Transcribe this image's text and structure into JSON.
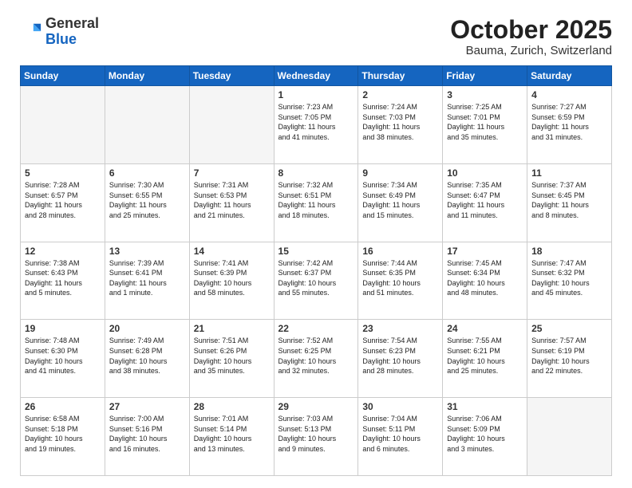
{
  "header": {
    "logo_general": "General",
    "logo_blue": "Blue",
    "month_title": "October 2025",
    "location": "Bauma, Zurich, Switzerland"
  },
  "days_of_week": [
    "Sunday",
    "Monday",
    "Tuesday",
    "Wednesday",
    "Thursday",
    "Friday",
    "Saturday"
  ],
  "weeks": [
    [
      {
        "day": "",
        "info": "",
        "empty": true
      },
      {
        "day": "",
        "info": "",
        "empty": true
      },
      {
        "day": "",
        "info": "",
        "empty": true
      },
      {
        "day": "1",
        "info": "Sunrise: 7:23 AM\nSunset: 7:05 PM\nDaylight: 11 hours\nand 41 minutes.",
        "empty": false
      },
      {
        "day": "2",
        "info": "Sunrise: 7:24 AM\nSunset: 7:03 PM\nDaylight: 11 hours\nand 38 minutes.",
        "empty": false
      },
      {
        "day": "3",
        "info": "Sunrise: 7:25 AM\nSunset: 7:01 PM\nDaylight: 11 hours\nand 35 minutes.",
        "empty": false
      },
      {
        "day": "4",
        "info": "Sunrise: 7:27 AM\nSunset: 6:59 PM\nDaylight: 11 hours\nand 31 minutes.",
        "empty": false
      }
    ],
    [
      {
        "day": "5",
        "info": "Sunrise: 7:28 AM\nSunset: 6:57 PM\nDaylight: 11 hours\nand 28 minutes.",
        "empty": false
      },
      {
        "day": "6",
        "info": "Sunrise: 7:30 AM\nSunset: 6:55 PM\nDaylight: 11 hours\nand 25 minutes.",
        "empty": false
      },
      {
        "day": "7",
        "info": "Sunrise: 7:31 AM\nSunset: 6:53 PM\nDaylight: 11 hours\nand 21 minutes.",
        "empty": false
      },
      {
        "day": "8",
        "info": "Sunrise: 7:32 AM\nSunset: 6:51 PM\nDaylight: 11 hours\nand 18 minutes.",
        "empty": false
      },
      {
        "day": "9",
        "info": "Sunrise: 7:34 AM\nSunset: 6:49 PM\nDaylight: 11 hours\nand 15 minutes.",
        "empty": false
      },
      {
        "day": "10",
        "info": "Sunrise: 7:35 AM\nSunset: 6:47 PM\nDaylight: 11 hours\nand 11 minutes.",
        "empty": false
      },
      {
        "day": "11",
        "info": "Sunrise: 7:37 AM\nSunset: 6:45 PM\nDaylight: 11 hours\nand 8 minutes.",
        "empty": false
      }
    ],
    [
      {
        "day": "12",
        "info": "Sunrise: 7:38 AM\nSunset: 6:43 PM\nDaylight: 11 hours\nand 5 minutes.",
        "empty": false
      },
      {
        "day": "13",
        "info": "Sunrise: 7:39 AM\nSunset: 6:41 PM\nDaylight: 11 hours\nand 1 minute.",
        "empty": false
      },
      {
        "day": "14",
        "info": "Sunrise: 7:41 AM\nSunset: 6:39 PM\nDaylight: 10 hours\nand 58 minutes.",
        "empty": false
      },
      {
        "day": "15",
        "info": "Sunrise: 7:42 AM\nSunset: 6:37 PM\nDaylight: 10 hours\nand 55 minutes.",
        "empty": false
      },
      {
        "day": "16",
        "info": "Sunrise: 7:44 AM\nSunset: 6:35 PM\nDaylight: 10 hours\nand 51 minutes.",
        "empty": false
      },
      {
        "day": "17",
        "info": "Sunrise: 7:45 AM\nSunset: 6:34 PM\nDaylight: 10 hours\nand 48 minutes.",
        "empty": false
      },
      {
        "day": "18",
        "info": "Sunrise: 7:47 AM\nSunset: 6:32 PM\nDaylight: 10 hours\nand 45 minutes.",
        "empty": false
      }
    ],
    [
      {
        "day": "19",
        "info": "Sunrise: 7:48 AM\nSunset: 6:30 PM\nDaylight: 10 hours\nand 41 minutes.",
        "empty": false
      },
      {
        "day": "20",
        "info": "Sunrise: 7:49 AM\nSunset: 6:28 PM\nDaylight: 10 hours\nand 38 minutes.",
        "empty": false
      },
      {
        "day": "21",
        "info": "Sunrise: 7:51 AM\nSunset: 6:26 PM\nDaylight: 10 hours\nand 35 minutes.",
        "empty": false
      },
      {
        "day": "22",
        "info": "Sunrise: 7:52 AM\nSunset: 6:25 PM\nDaylight: 10 hours\nand 32 minutes.",
        "empty": false
      },
      {
        "day": "23",
        "info": "Sunrise: 7:54 AM\nSunset: 6:23 PM\nDaylight: 10 hours\nand 28 minutes.",
        "empty": false
      },
      {
        "day": "24",
        "info": "Sunrise: 7:55 AM\nSunset: 6:21 PM\nDaylight: 10 hours\nand 25 minutes.",
        "empty": false
      },
      {
        "day": "25",
        "info": "Sunrise: 7:57 AM\nSunset: 6:19 PM\nDaylight: 10 hours\nand 22 minutes.",
        "empty": false
      }
    ],
    [
      {
        "day": "26",
        "info": "Sunrise: 6:58 AM\nSunset: 5:18 PM\nDaylight: 10 hours\nand 19 minutes.",
        "empty": false
      },
      {
        "day": "27",
        "info": "Sunrise: 7:00 AM\nSunset: 5:16 PM\nDaylight: 10 hours\nand 16 minutes.",
        "empty": false
      },
      {
        "day": "28",
        "info": "Sunrise: 7:01 AM\nSunset: 5:14 PM\nDaylight: 10 hours\nand 13 minutes.",
        "empty": false
      },
      {
        "day": "29",
        "info": "Sunrise: 7:03 AM\nSunset: 5:13 PM\nDaylight: 10 hours\nand 9 minutes.",
        "empty": false
      },
      {
        "day": "30",
        "info": "Sunrise: 7:04 AM\nSunset: 5:11 PM\nDaylight: 10 hours\nand 6 minutes.",
        "empty": false
      },
      {
        "day": "31",
        "info": "Sunrise: 7:06 AM\nSunset: 5:09 PM\nDaylight: 10 hours\nand 3 minutes.",
        "empty": false
      },
      {
        "day": "",
        "info": "",
        "empty": true
      }
    ]
  ]
}
